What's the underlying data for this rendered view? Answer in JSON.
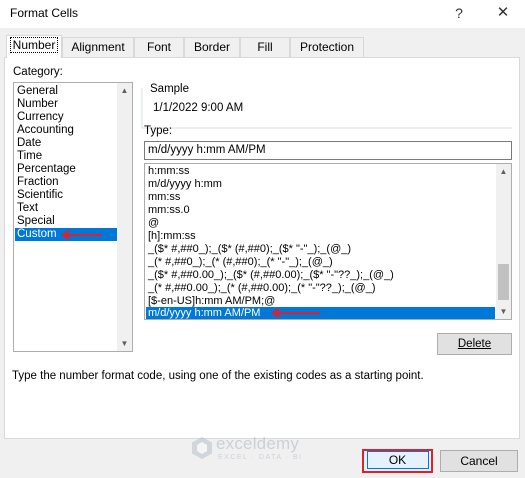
{
  "window": {
    "title": "Format Cells",
    "help_glyph": "?",
    "close_glyph": "✕"
  },
  "tabs": [
    {
      "label": "Number",
      "active": true
    },
    {
      "label": "Alignment"
    },
    {
      "label": "Font"
    },
    {
      "label": "Border"
    },
    {
      "label": "Fill"
    },
    {
      "label": "Protection"
    }
  ],
  "category": {
    "label": "Category:",
    "items": [
      "General",
      "Number",
      "Currency",
      "Accounting",
      "Date",
      "Time",
      "Percentage",
      "Fraction",
      "Scientific",
      "Text",
      "Special",
      "Custom"
    ],
    "selected": "Custom"
  },
  "sample": {
    "legend": "Sample",
    "value": "1/1/2022 9:00 AM"
  },
  "type": {
    "label": "Type:",
    "value": "m/d/yyyy h:mm AM/PM",
    "formats": [
      "h:mm:ss",
      "m/d/yyyy h:mm",
      "mm:ss",
      "mm:ss.0",
      "@",
      "[h]:mm:ss",
      "_($* #,##0_);_($* (#,##0);_($* \"-\"_);_(@_)",
      "_(* #,##0_);_(* (#,##0);_(* \"-\"_);_(@_)",
      "_($* #,##0.00_);_($* (#,##0.00);_($* \"-\"??_);_(@_)",
      "_(* #,##0.00_);_(* (#,##0.00);_(* \"-\"??_);_(@_)",
      "[$-en-US]h:mm AM/PM;@",
      "m/d/yyyy h:mm AM/PM"
    ],
    "selected": "m/d/yyyy h:mm AM/PM"
  },
  "buttons": {
    "delete": "Delete",
    "ok": "OK",
    "cancel": "Cancel"
  },
  "help_text": "Type the number format code, using one of the existing codes as a starting point.",
  "watermark": {
    "name": "exceldemy",
    "tagline": "EXCEL · DATA · BI"
  },
  "colors": {
    "selection": "#0078d7",
    "annotation": "#e0202a",
    "dialog_bg": "#f0f0f0"
  }
}
